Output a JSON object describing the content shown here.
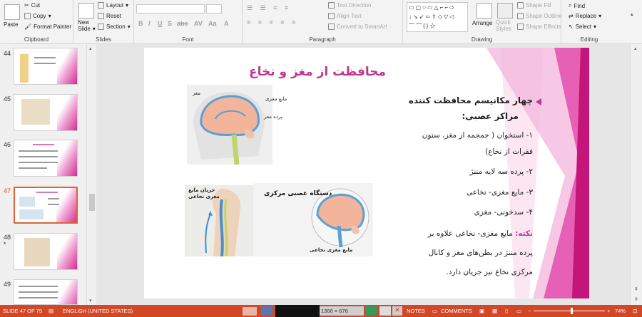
{
  "ribbon": {
    "clipboard": {
      "paste": "Paste",
      "cut": "Cut",
      "copy": "Copy",
      "format_painter": "Format Painter",
      "label": "Clipboard"
    },
    "slides": {
      "new_slide_1": "New",
      "new_slide_2": "Slide",
      "layout": "Layout",
      "reset": "Reset",
      "section": "Section",
      "label": "Slides"
    },
    "font": {
      "bold": "B",
      "italic": "I",
      "underline": "U",
      "shadow": "S",
      "strike": "abc",
      "spacing": "AV",
      "case": "Aa",
      "color": "A",
      "label": "Font"
    },
    "paragraph": {
      "text_direction": "Text Direction",
      "align_text": "Align Text",
      "smartart": "Convert to SmartArt",
      "label": "Paragraph"
    },
    "drawing": {
      "arrange": "Arrange",
      "quick_styles_1": "Quick",
      "quick_styles_2": "Styles",
      "shape_fill": "Shape Fill",
      "shape_outline": "Shape Outline",
      "shape_effects": "Shape Effects",
      "label": "Drawing"
    },
    "editing": {
      "find": "Find",
      "replace": "Replace",
      "select": "Select",
      "label": "Editing"
    }
  },
  "thumbnails": [
    {
      "number": "44"
    },
    {
      "number": "45"
    },
    {
      "number": "46"
    },
    {
      "number": "47"
    },
    {
      "number": "48",
      "star": "*"
    },
    {
      "number": "49"
    }
  ],
  "slide": {
    "title": "محافظت از مغز و نخاع",
    "bullet1": "چهار مکانیسم محافظت کننده",
    "bullet1b": "مراکز عصبی:",
    "item1": "۱- استخوان ( جمجمه از مغز، ستون",
    "item1b": "فقرات از نخاع)",
    "item2": "۲- پرده سه لایه مننژ",
    "item3": "۳- مایع مغزی- نخاعی",
    "item4": "۴- سدخونی- مغزی",
    "note_key": "نکته:",
    "note1": " مایع مغزی- نخاعی علاوه بر",
    "note2": "پرده مننژ در بطن‌های مغز و کانال",
    "note3": "مرکزی نخاع نیز جریان دارد.",
    "img_labels": {
      "brain": "مغز",
      "fluid": "مایع مغزی",
      "medulla": "پرده مغز",
      "flow1": "جریان مایع",
      "flow2": "مغزی نخاعی",
      "cns": "دستگاه عصبی مرکزی",
      "csf": "مایع مغزی نخاعی"
    }
  },
  "status": {
    "slide_of": "SLIDE 47 OF 75",
    "language": "ENGLISH (UNITED STATES)",
    "resolution": "1366 × 676",
    "notes": "NOTES",
    "comments": "COMMENTS",
    "zoom": "74%"
  }
}
